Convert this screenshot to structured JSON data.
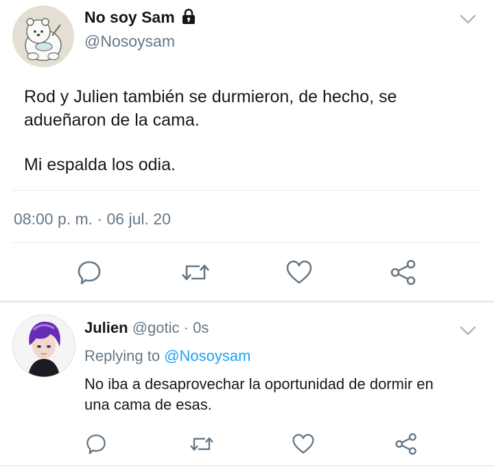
{
  "tweet": {
    "author_name": "No soy Sam",
    "author_handle": "@Nosoysam",
    "text_line1": "Rod y Julien también se durmieron, de hecho, se",
    "text_line2": "adueñaron de la cama.",
    "text_line3": "Mi espalda los odia.",
    "timestamp": "08:00 p. m. · 06 jul. 20",
    "protected_icon": "lock-icon"
  },
  "actions": [
    "reply-icon",
    "retweet-icon",
    "like-icon",
    "share-icon"
  ],
  "reply": {
    "author_name": "Julien",
    "author_handle": "@gotic",
    "time": "· 0s",
    "replying_label": "Replying to",
    "replying_to": "@Nosoysam",
    "text_line1": "No iba a desaprovechar la oportunidad de dormir en",
    "text_line2": "una cama de esas."
  },
  "colors": {
    "text": "#14171a",
    "secondary": "#657786",
    "accent": "#1da1f2",
    "divider": "#e6ecf0"
  }
}
